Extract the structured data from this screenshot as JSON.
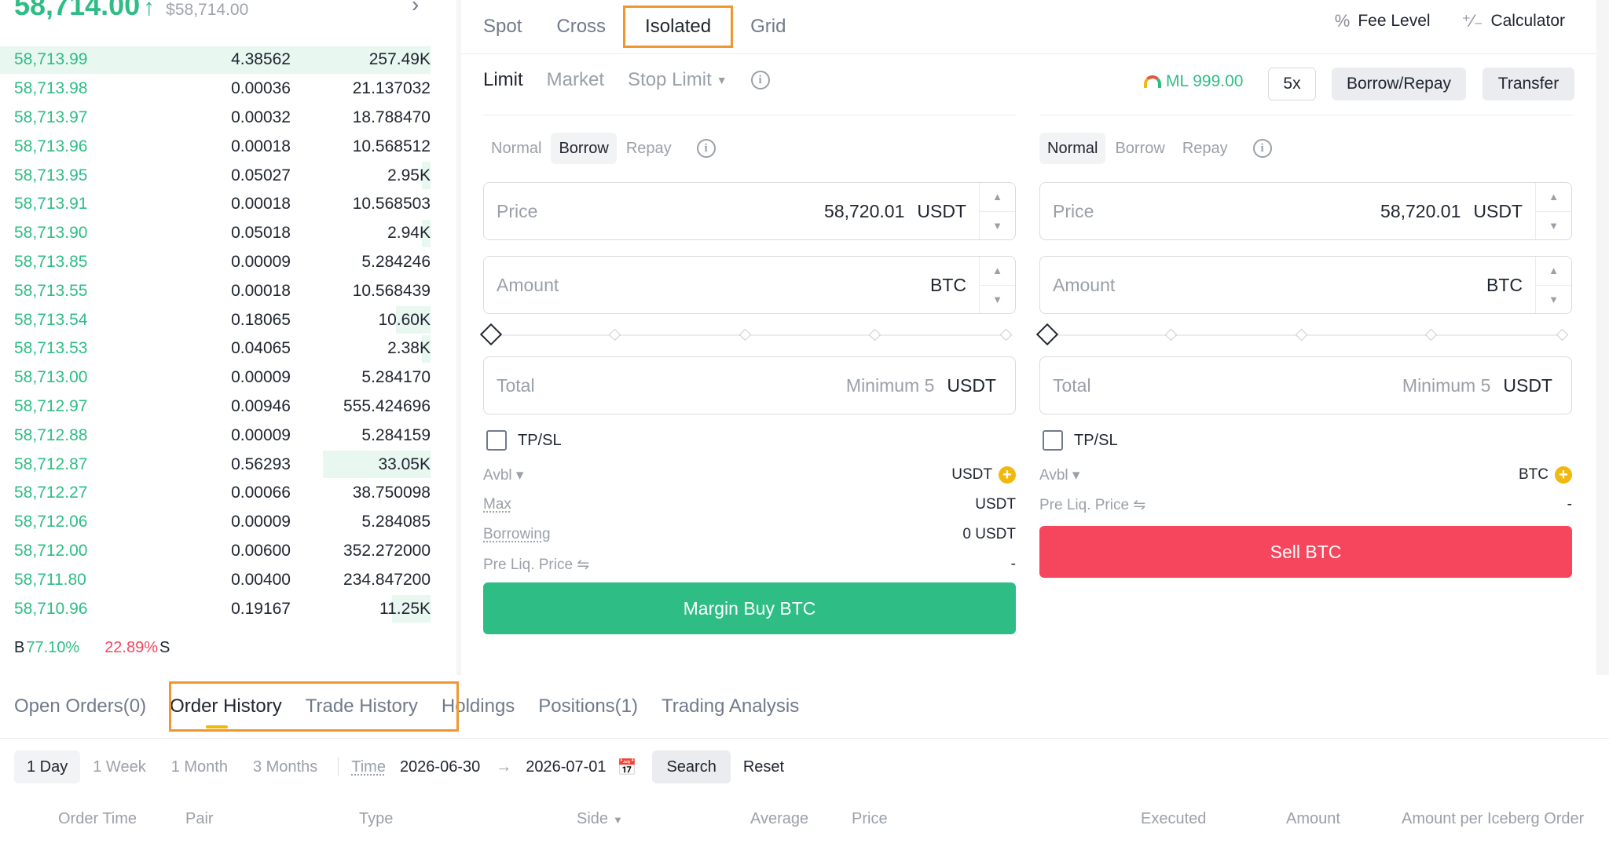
{
  "order_book": {
    "last_price": "58,714.00",
    "last_arrow": "↑",
    "last_usd": "$58,714.00",
    "chevron": "›",
    "rows": [
      {
        "price": "58,713.99",
        "amount": "4.38562",
        "total": "257.49K",
        "depth": 1.0
      },
      {
        "price": "58,713.98",
        "amount": "0.00036",
        "total": "21.137032",
        "depth": 0
      },
      {
        "price": "58,713.97",
        "amount": "0.00032",
        "total": "18.788470",
        "depth": 0
      },
      {
        "price": "58,713.96",
        "amount": "0.00018",
        "total": "10.568512",
        "depth": 0
      },
      {
        "price": "58,713.95",
        "amount": "0.05027",
        "total": "2.95K",
        "depth": 0.02
      },
      {
        "price": "58,713.91",
        "amount": "0.00018",
        "total": "10.568503",
        "depth": 0
      },
      {
        "price": "58,713.90",
        "amount": "0.05018",
        "total": "2.94K",
        "depth": 0.02
      },
      {
        "price": "58,713.85",
        "amount": "0.00009",
        "total": "5.284246",
        "depth": 0
      },
      {
        "price": "58,713.55",
        "amount": "0.00018",
        "total": "10.568439",
        "depth": 0
      },
      {
        "price": "58,713.54",
        "amount": "0.18065",
        "total": "10.60K",
        "depth": 0.08
      },
      {
        "price": "58,713.53",
        "amount": "0.04065",
        "total": "2.38K",
        "depth": 0.02
      },
      {
        "price": "58,713.00",
        "amount": "0.00009",
        "total": "5.284170",
        "depth": 0
      },
      {
        "price": "58,712.97",
        "amount": "0.00946",
        "total": "555.424696",
        "depth": 0
      },
      {
        "price": "58,712.88",
        "amount": "0.00009",
        "total": "5.284159",
        "depth": 0
      },
      {
        "price": "58,712.87",
        "amount": "0.56293",
        "total": "33.05K",
        "depth": 0.25
      },
      {
        "price": "58,712.27",
        "amount": "0.00066",
        "total": "38.750098",
        "depth": 0
      },
      {
        "price": "58,712.06",
        "amount": "0.00009",
        "total": "5.284085",
        "depth": 0
      },
      {
        "price": "58,712.00",
        "amount": "0.00600",
        "total": "352.272000",
        "depth": 0
      },
      {
        "price": "58,711.80",
        "amount": "0.00400",
        "total": "234.847200",
        "depth": 0
      },
      {
        "price": "58,710.96",
        "amount": "0.19167",
        "total": "11.25K",
        "depth": 0.09
      }
    ],
    "buy_label": "B",
    "buy_pct": "77.10%",
    "sell_pct": "22.89%",
    "sell_label": "S"
  },
  "trade": {
    "mode_tabs": [
      "Spot",
      "Cross",
      "Isolated",
      "Grid"
    ],
    "active_mode": "Isolated",
    "fee_level_icon": "percent-icon",
    "fee_level": "Fee Level",
    "calculator_icon": "calculator-icon",
    "calculator": "Calculator",
    "order_types": {
      "limit": "Limit",
      "market": "Market",
      "stop_limit": "Stop Limit",
      "caret": "▼"
    },
    "info": "i",
    "margin_level": "ML 999.00",
    "leverage": "5x",
    "borrow_repay": "Borrow/Repay",
    "transfer": "Transfer",
    "buy": {
      "tabs": [
        "Normal",
        "Borrow",
        "Repay"
      ],
      "active_tab": "Borrow",
      "price_label": "Price",
      "price_value": "58,720.01",
      "price_unit": "USDT",
      "amount_label": "Amount",
      "amount_unit": "BTC",
      "total_label": "Total",
      "total_placeholder": "Minimum 5",
      "total_unit": "USDT",
      "tpsl": "TP/SL",
      "avbl_label": "Avbl ▾",
      "avbl_value": "USDT",
      "max_label": "Max",
      "max_value": "USDT",
      "borrowing_label": "Borrowing",
      "borrowing_value": "0 USDT",
      "preliq_label": "Pre Liq. Price ⇋",
      "preliq_value": "-",
      "button": "Margin Buy BTC"
    },
    "sell": {
      "tabs": [
        "Normal",
        "Borrow",
        "Repay"
      ],
      "active_tab": "Normal",
      "price_label": "Price",
      "price_value": "58,720.01",
      "price_unit": "USDT",
      "amount_label": "Amount",
      "amount_unit": "BTC",
      "total_label": "Total",
      "total_placeholder": "Minimum 5",
      "total_unit": "USDT",
      "tpsl": "TP/SL",
      "avbl_label": "Avbl ▾",
      "avbl_value": "BTC",
      "preliq_label": "Pre Liq. Price ⇋",
      "preliq_value": "-",
      "button": "Sell BTC"
    },
    "colors": {
      "buy": "#2ebd85",
      "sell": "#f6465d",
      "accent": "#f0b90b",
      "highlight": "#f0962e"
    }
  },
  "orders": {
    "tabs": [
      "Open Orders(0)",
      "Order History",
      "Trade History",
      "Holdings",
      "Positions(1)",
      "Trading Analysis"
    ],
    "active_tab": "Order History",
    "ranges": [
      "1 Day",
      "1 Week",
      "1 Month",
      "3 Months"
    ],
    "active_range": "1 Day",
    "time_label": "Time",
    "start_date": "2026-06-30",
    "arrow": "→",
    "end_date": "2026-07-01",
    "calendar_icon": "calendar-icon",
    "search": "Search",
    "reset": "Reset",
    "columns": [
      "Order Time",
      "Pair",
      "Type",
      "Side",
      "Average",
      "Price",
      "Executed",
      "Amount",
      "Amount per Iceberg Order"
    ]
  }
}
